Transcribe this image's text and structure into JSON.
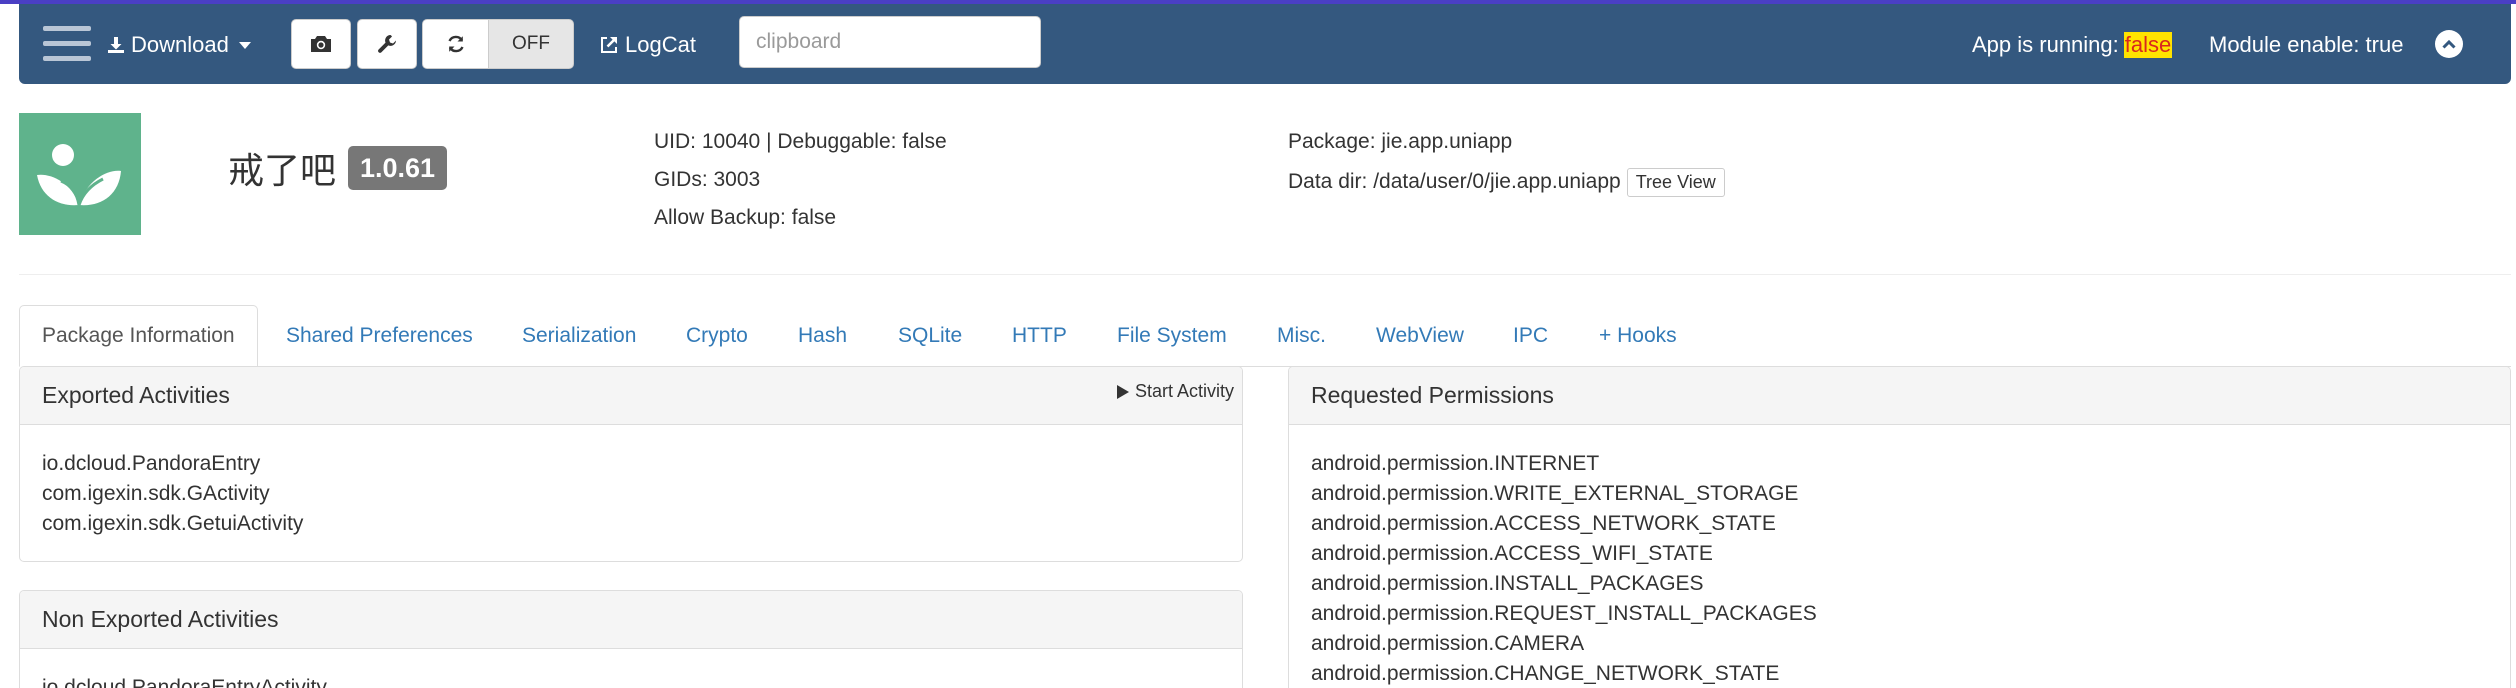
{
  "navbar": {
    "download_label": "Download",
    "toggle_off_label": "OFF",
    "logcat_label": "LogCat",
    "clipboard_placeholder": "clipboard",
    "app_running_label": "App is running:",
    "app_running_value": "false",
    "module_enable": "Module enable: true",
    "background_color": "#34587f"
  },
  "app": {
    "name": "戒了吧",
    "version": "1.0.61",
    "uid_line": "UID: 10040 | Debuggable: false",
    "gids_line": "GIDs: 3003",
    "allow_backup_line": "Allow Backup: false",
    "package_line": "Package: jie.app.uniapp",
    "data_dir_line": "Data dir: /data/user/0/jie.app.uniapp",
    "tree_view_label": "Tree View",
    "icon_color": "#5fb38c"
  },
  "tabs": [
    {
      "label": "Package Information",
      "active": true
    },
    {
      "label": "Shared Preferences"
    },
    {
      "label": "Serialization"
    },
    {
      "label": "Crypto"
    },
    {
      "label": "Hash"
    },
    {
      "label": "SQLite"
    },
    {
      "label": "HTTP"
    },
    {
      "label": "File System"
    },
    {
      "label": "Misc."
    },
    {
      "label": "WebView"
    },
    {
      "label": "IPC"
    },
    {
      "label": "+ Hooks"
    }
  ],
  "exported_activities": {
    "title": "Exported Activities",
    "start_label": "Start Activity",
    "items": [
      "io.dcloud.PandoraEntry",
      "com.igexin.sdk.GActivity",
      "com.igexin.sdk.GetuiActivity"
    ]
  },
  "non_exported_activities": {
    "title": "Non Exported Activities",
    "items": [
      "io.dcloud.PandoraEntryActivity"
    ]
  },
  "requested_permissions": {
    "title": "Requested Permissions",
    "items": [
      "android.permission.INTERNET",
      "android.permission.WRITE_EXTERNAL_STORAGE",
      "android.permission.ACCESS_NETWORK_STATE",
      "android.permission.ACCESS_WIFI_STATE",
      "android.permission.INSTALL_PACKAGES",
      "android.permission.REQUEST_INSTALL_PACKAGES",
      "android.permission.CAMERA",
      "android.permission.CHANGE_NETWORK_STATE"
    ]
  }
}
